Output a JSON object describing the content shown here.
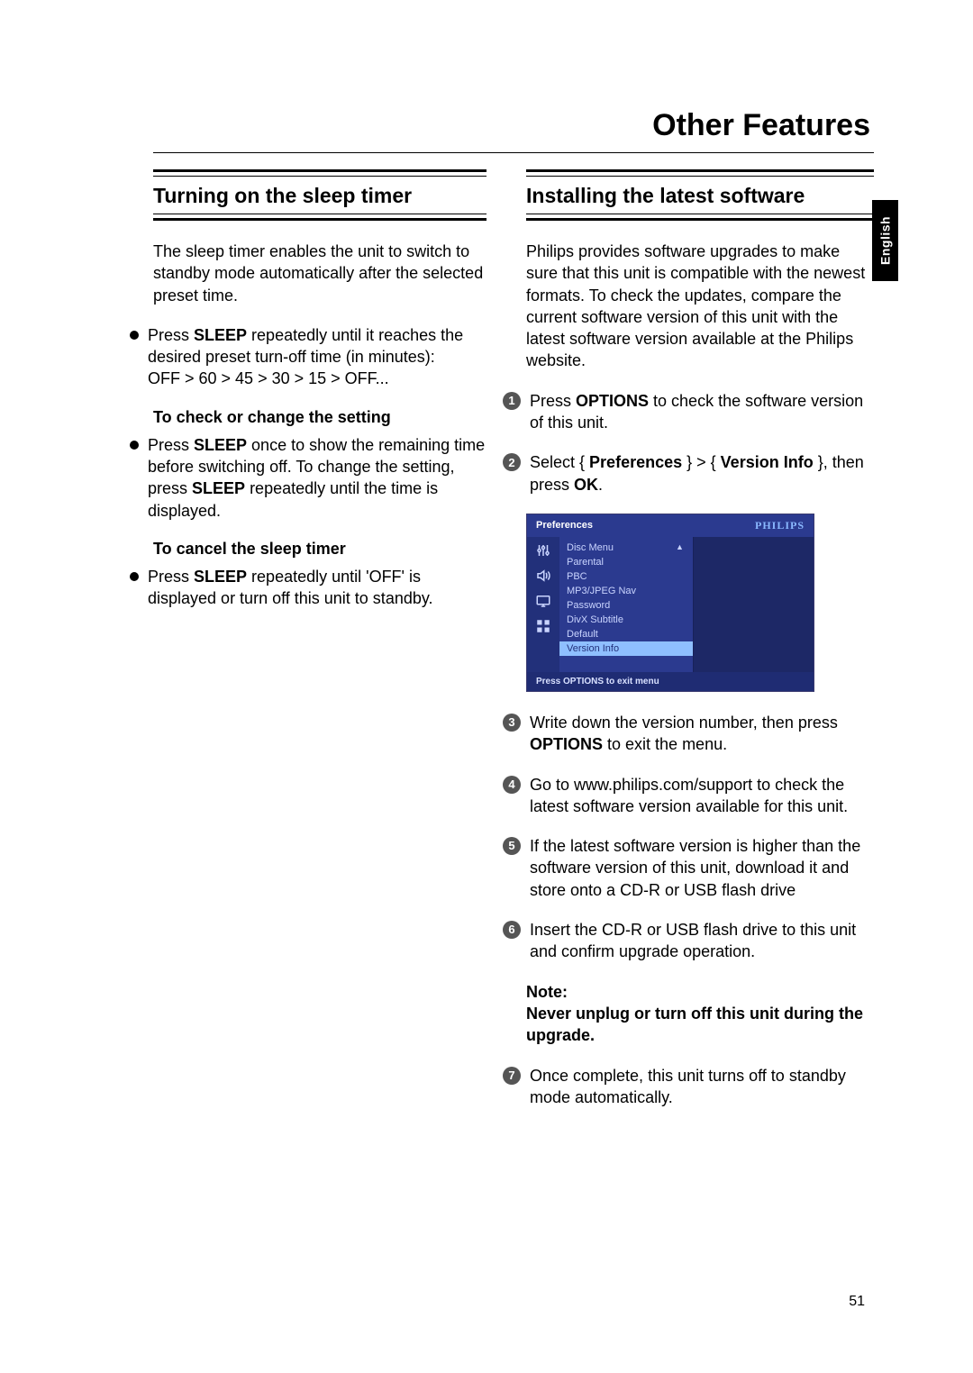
{
  "page_title": "Other Features",
  "language_tab": "English",
  "page_number": "51",
  "left": {
    "heading": "Turning on the sleep timer",
    "intro": "The sleep timer enables the unit to switch to standby mode automatically after the selected preset time.",
    "bullet1_pre": "Press ",
    "bullet1_bold": "SLEEP",
    "bullet1_post": " repeatedly until it reaches the desired preset turn-off time (in minutes):",
    "bullet1_seq": "OFF > 60 > 45 > 30 > 15 > OFF...",
    "sub1": "To check or change the setting",
    "bullet2_pre": "Press ",
    "bullet2_bold1": "SLEEP",
    "bullet2_mid": " once to show the remaining time before switching off. To change the setting, press ",
    "bullet2_bold2": "SLEEP",
    "bullet2_post": " repeatedly until the time is displayed.",
    "sub2": "To cancel the sleep timer",
    "bullet3_pre": "Press ",
    "bullet3_bold": "SLEEP",
    "bullet3_post": " repeatedly until 'OFF' is displayed or turn off this unit to standby."
  },
  "right": {
    "heading": "Installing the latest software",
    "intro": "Philips provides software upgrades to make sure that this unit is compatible with the newest formats. To check the updates, compare the current software version of this unit with the latest software version available at the Philips website.",
    "step1_pre": "Press ",
    "step1_bold": "OPTIONS",
    "step1_post": " to check the software version of this unit.",
    "step2_pre": "Select { ",
    "step2_bold1": "Preferences",
    "step2_mid": " } > { ",
    "step2_bold2": "Version Info",
    "step2_mid2": " }, then press ",
    "step2_bold3": "OK",
    "step2_post": ".",
    "step3_pre": "Write down the version number, then press ",
    "step3_bold": "OPTIONS",
    "step3_post": " to exit the menu.",
    "step4": "Go to www.philips.com/support to check the latest software version available for this unit.",
    "step5": "If the latest software version is higher than the software version of this unit, download it and store onto a CD-R or USB flash drive",
    "step6": "Insert the CD-R or USB flash drive to this unit and confirm upgrade operation.",
    "note_label": "Note:",
    "note_text": "Never unplug or turn off this unit during the upgrade.",
    "step7": "Once complete, this unit turns off to standby mode automatically."
  },
  "osd": {
    "header_title": "Preferences",
    "logo": "PHILIPS",
    "items": [
      "Disc Menu",
      "Parental",
      "PBC",
      "MP3/JPEG Nav",
      "Password",
      "DivX Subtitle",
      "Default",
      "Version Info"
    ],
    "footer": "Press OPTIONS to exit menu"
  }
}
